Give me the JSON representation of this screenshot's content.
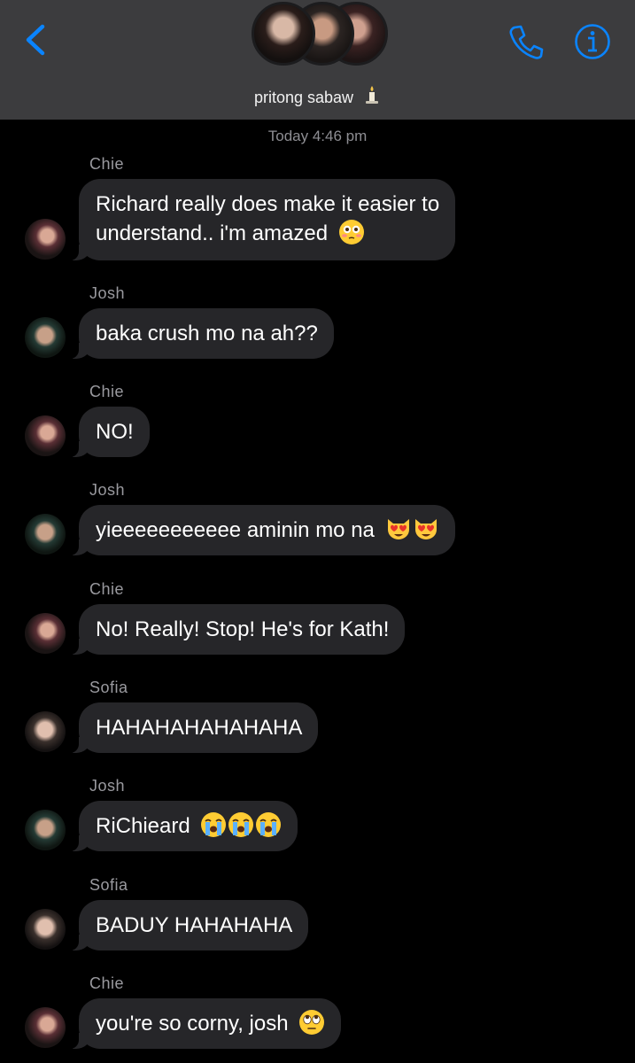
{
  "header": {
    "group_name": "pritong sabaw",
    "back_icon": "chevron-left-icon",
    "call_icon": "phone-icon",
    "info_icon": "info-icon",
    "accent_color": "#0a84ff"
  },
  "conversation": {
    "timestamp": "Today 4:46 pm",
    "messages": [
      {
        "sender": "Chie",
        "line1": "Richard really does make it easier to",
        "line2": "understand.. i'm amazed",
        "emoji": [
          "flushed-face"
        ]
      },
      {
        "sender": "Josh",
        "text": "baka crush mo na ah??"
      },
      {
        "sender": "Chie",
        "text": "NO!"
      },
      {
        "sender": "Josh",
        "text": "yieeeeeeeeeee aminin mo na",
        "emoji": [
          "heart-eyes-cat",
          "heart-eyes-cat"
        ]
      },
      {
        "sender": "Chie",
        "text": "No! Really! Stop! He's for Kath!"
      },
      {
        "sender": "Sofia",
        "text": "HAHAHAHAHAHAHA"
      },
      {
        "sender": "Josh",
        "text": "RiChieard",
        "emoji": [
          "loudly-crying-face",
          "loudly-crying-face",
          "loudly-crying-face"
        ]
      },
      {
        "sender": "Sofia",
        "text": "BADUY HAHAHAHA"
      },
      {
        "sender": "Chie",
        "text": "you're so corny, josh",
        "emoji": [
          "face-with-rolling-eyes"
        ]
      }
    ]
  }
}
